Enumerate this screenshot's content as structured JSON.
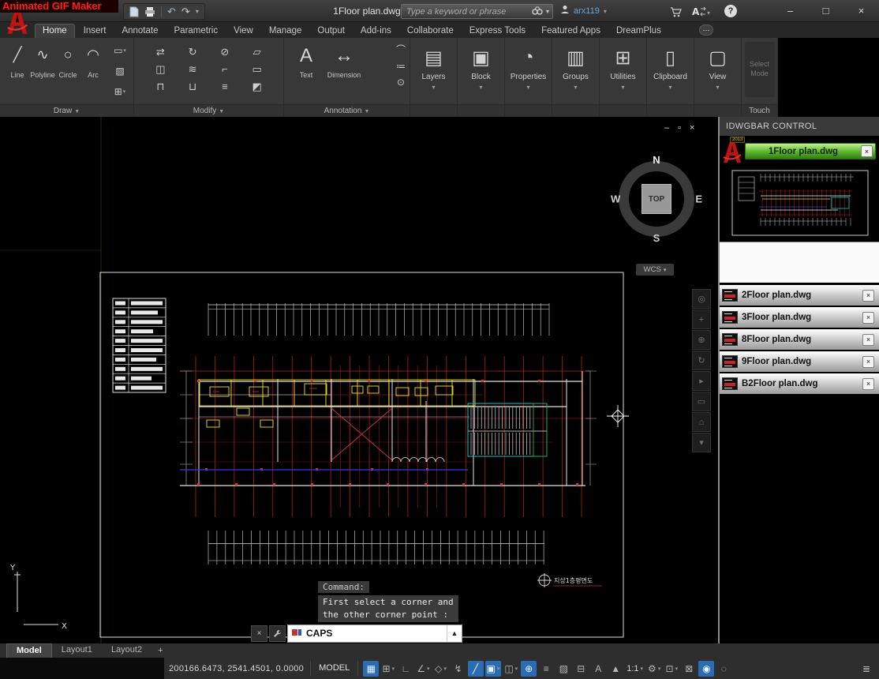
{
  "overlay": {
    "banner": "Animated GIF Maker"
  },
  "titlebar": {
    "title": "1Floor plan.dwg",
    "search_placeholder": "Type a keyword or phrase",
    "username": "arx119"
  },
  "ribbon": {
    "active_tab": "Home",
    "tabs": [
      "Home",
      "Insert",
      "Annotate",
      "Parametric",
      "View",
      "Manage",
      "Output",
      "Add-ins",
      "Collaborate",
      "Express Tools",
      "Featured Apps",
      "DreamPlus"
    ],
    "panels": {
      "draw": {
        "label": "Draw",
        "tools": [
          {
            "name": "line-tool-icon",
            "glyph": "╱",
            "label": "Line"
          },
          {
            "name": "polyline-tool-icon",
            "glyph": "∿",
            "label": "Polyline"
          },
          {
            "name": "circle-tool-icon",
            "glyph": "○",
            "label": "Circle"
          },
          {
            "name": "arc-tool-icon",
            "glyph": "◠",
            "label": "Arc"
          }
        ],
        "mini": [
          {
            "name": "rectangle-tool-icon",
            "glyph": "▭",
            "dd": true
          },
          {
            "name": "hatch-tool-icon",
            "glyph": "▨",
            "dd": false
          },
          {
            "name": "array-tool-icon",
            "glyph": "⊞",
            "dd": true
          }
        ]
      },
      "modify": {
        "label": "Modify",
        "tools": [
          "⇄",
          "↻",
          "⊘",
          "▱",
          "◫",
          "≋",
          "⌐",
          "▭",
          "⊓",
          "⊔",
          "≡",
          "◩"
        ]
      },
      "annotation": {
        "label": "Annotation",
        "tools": [
          {
            "name": "text-tool-icon",
            "glyph": "A",
            "label": "Text"
          },
          {
            "name": "dimension-tool-icon",
            "glyph": "↔",
            "label": "Dimension"
          }
        ],
        "mini": [
          "⌒",
          "≔",
          "⊙"
        ]
      },
      "big": [
        {
          "name": "layers",
          "label": "Layers",
          "glyph": "▤"
        },
        {
          "name": "block",
          "label": "Block",
          "glyph": "▣"
        },
        {
          "name": "properties",
          "label": "Properties",
          "glyph": "◔"
        },
        {
          "name": "groups",
          "label": "Groups",
          "glyph": "▥"
        },
        {
          "name": "utilities",
          "label": "Utilities",
          "glyph": "⊞"
        },
        {
          "name": "clipboard",
          "label": "Clipboard",
          "glyph": "▯"
        },
        {
          "name": "view",
          "label": "View",
          "glyph": "▢"
        }
      ],
      "select_mode": "Select Mode",
      "touch": "Touch"
    }
  },
  "canvas": {
    "viewcube": {
      "north": "N",
      "south": "S",
      "east": "E",
      "west": "W",
      "top": "TOP"
    },
    "wcs": "WCS",
    "drawing_label": "지상1층평면도",
    "command_history": "Command:",
    "prompt_line1": "First select a corner and",
    "prompt_line2": "the other corner point :",
    "command_input": "CAPS",
    "navbar_icons": [
      {
        "name": "full-navigation-wheel-icon",
        "glyph": "◎"
      },
      {
        "name": "pan-icon",
        "glyph": "+"
      },
      {
        "name": "zoom-icon",
        "glyph": "⊕"
      },
      {
        "name": "orbit-icon",
        "glyph": "↻"
      },
      {
        "name": "showmotion-icon",
        "glyph": "▸"
      },
      {
        "name": "previous-view-icon",
        "glyph": "▭"
      },
      {
        "name": "home-view-icon",
        "glyph": "⌂"
      },
      {
        "name": "navbar-menu-icon",
        "glyph": "▾"
      }
    ]
  },
  "sidebar": {
    "title": "IDWGBAR CONTROL",
    "logo_year": "2013",
    "active_file": "1Floor plan.dwg",
    "files": [
      "2Floor plan.dwg",
      "3Floor plan.dwg",
      "8Floor plan.dwg",
      "9Floor plan.dwg",
      "B2Floor plan.dwg"
    ]
  },
  "layout": {
    "tabs": [
      "Model",
      "Layout1",
      "Layout2"
    ],
    "active": "Model",
    "add_label": "+"
  },
  "statusbar": {
    "coordinates": "200166.6473, 2541.4501, 0.0000",
    "model_label": "MODEL",
    "icons": [
      {
        "name": "grid-display-icon",
        "glyph": "▦",
        "active": true
      },
      {
        "name": "snap-mode-icon",
        "glyph": "⊞",
        "dd": true
      },
      {
        "name": "ortho-mode-icon",
        "glyph": "∟"
      },
      {
        "name": "polar-tracking-icon",
        "glyph": "∠",
        "dd": true
      },
      {
        "name": "isometric-drafting-icon",
        "glyph": "◇",
        "dd": true
      },
      {
        "name": "object-snap-tracking-icon",
        "glyph": "↯"
      },
      {
        "name": "isoplane-icon",
        "glyph": "╱",
        "active": true
      },
      {
        "name": "object-snap-icon",
        "glyph": "▣",
        "active": true,
        "dd": true
      },
      {
        "name": "3d-object-snap-icon",
        "glyph": "◫",
        "dd": true
      },
      {
        "name": "dynamic-input-icon",
        "glyph": "⊕",
        "active": true
      },
      {
        "name": "lineweight-icon",
        "glyph": "≡"
      },
      {
        "name": "transparency-icon",
        "glyph": "▨"
      },
      {
        "name": "selection-cycling-icon",
        "glyph": "⊟"
      },
      {
        "name": "annotation-visibility-icon",
        "glyph": "A"
      },
      {
        "name": "autoscale-icon",
        "glyph": "▲"
      },
      {
        "name": "annotation-scale-icon",
        "text": "1:1",
        "dd": true
      },
      {
        "name": "workspace-settings-icon",
        "glyph": "⚙",
        "dd": true
      },
      {
        "name": "annotation-monitor-icon",
        "glyph": "⊡",
        "dd": true
      },
      {
        "name": "quick-properties-icon",
        "glyph": "⊠"
      },
      {
        "name": "hardware-acceleration-icon",
        "glyph": "◉",
        "active": true
      },
      {
        "name": "isolate-objects-icon",
        "glyph": "◌"
      },
      {
        "name": "customization-icon",
        "glyph": "≣",
        "right": true
      }
    ]
  }
}
